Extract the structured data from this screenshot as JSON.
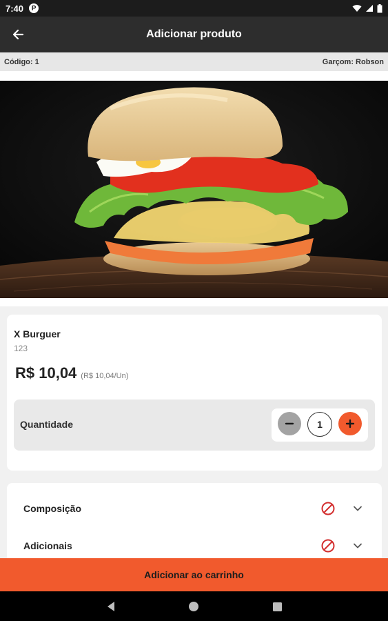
{
  "status_bar": {
    "time": "7:40",
    "notification_badge": "P",
    "icons": [
      "wifi-icon",
      "signal-icon",
      "battery-icon"
    ]
  },
  "app_bar": {
    "title": "Adicionar produto",
    "back_icon": "arrow-left-icon"
  },
  "info": {
    "code": "Código: 1",
    "waiter": "Garçom: Robson"
  },
  "hero_image": {
    "subject": "burger-photo"
  },
  "product": {
    "name": "X Burguer",
    "code": "123",
    "price": "R$ 10,04",
    "unit_price": "(R$ 10,04/Un)"
  },
  "quantity": {
    "label": "Quantidade",
    "value": "1",
    "minus_icon": "minus-icon",
    "plus_icon": "plus-icon"
  },
  "options": [
    {
      "label": "Composição",
      "status_icon": "blocked-icon",
      "expand_icon": "chevron-down-icon"
    },
    {
      "label": "Adicionais",
      "status_icon": "blocked-icon",
      "expand_icon": "chevron-down-icon"
    }
  ],
  "footer": {
    "add_to_cart": "Adicionar ao carrinho"
  },
  "nav": {
    "icons": [
      "back-triangle-icon",
      "home-circle-icon",
      "recents-square-icon"
    ]
  },
  "colors": {
    "accent": "#f15a2d",
    "app_bar": "#2d2d2d",
    "block_icon": "#d32f2f"
  }
}
